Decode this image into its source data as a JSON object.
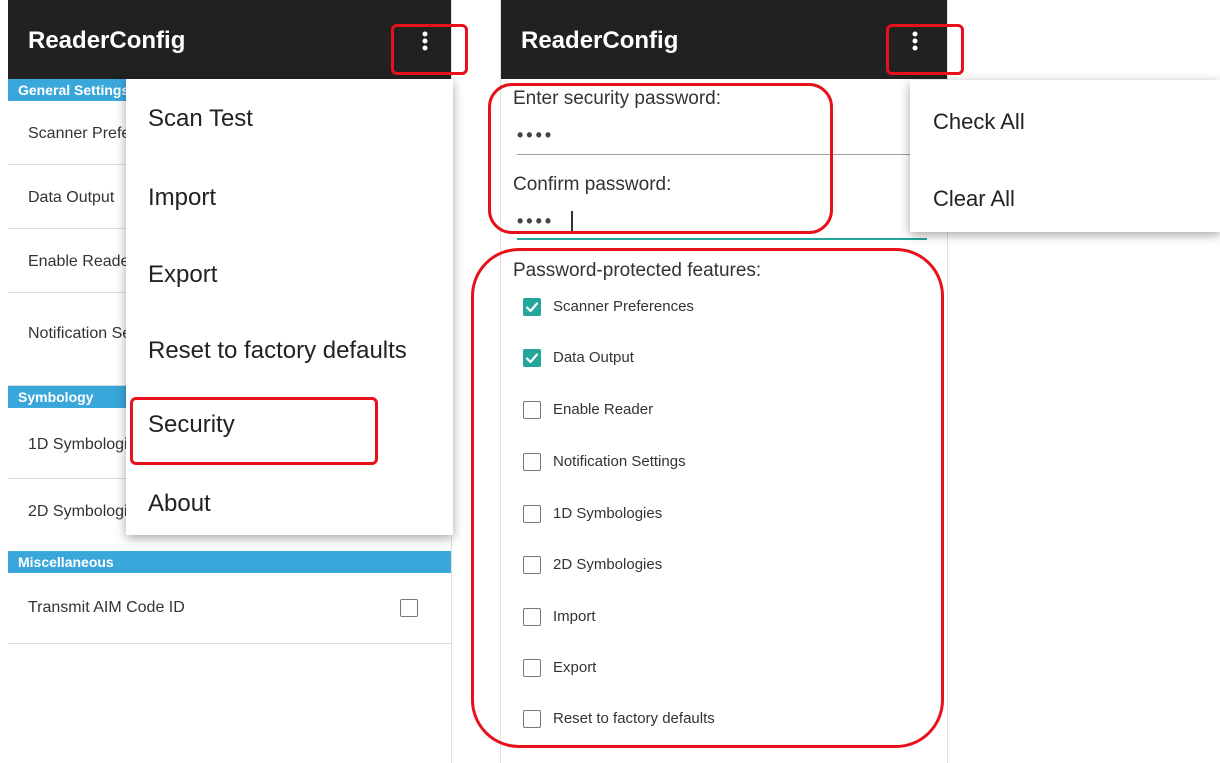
{
  "left_screen": {
    "app_title": "ReaderConfig",
    "sections": {
      "general": "General Settings",
      "symbology": "Symbology",
      "misc": "Miscellaneous"
    },
    "rows": {
      "scanner_preferences": "Scanner Preferences",
      "data_output": "Data Output",
      "enable_reader": "Enable Reader",
      "notification": "Notification Settings",
      "symbologies_1d": "1D Symbologies",
      "symbologies_2d": "2D Symbologies",
      "transmit_aim": "Transmit AIM Code ID"
    },
    "overflow_menu": {
      "scan_test": "Scan Test",
      "import": "Import",
      "export": "Export",
      "reset": "Reset to factory defaults",
      "security": "Security",
      "about": "About"
    }
  },
  "right_screen": {
    "app_title": "ReaderConfig",
    "password_label": "Enter security password:",
    "password_value": "••••",
    "confirm_label": "Confirm password:",
    "confirm_value": "••••",
    "features_label": "Password-protected features:",
    "features": [
      {
        "label": "Scanner Preferences",
        "checked": true
      },
      {
        "label": "Data Output",
        "checked": true
      },
      {
        "label": "Enable Reader",
        "checked": false
      },
      {
        "label": "Notification Settings",
        "checked": false
      },
      {
        "label": "1D Symbologies",
        "checked": false
      },
      {
        "label": "2D Symbologies",
        "checked": false
      },
      {
        "label": "Import",
        "checked": false
      },
      {
        "label": "Export",
        "checked": false
      },
      {
        "label": "Reset to factory defaults",
        "checked": false
      }
    ],
    "popup_menu": {
      "check_all": "Check All",
      "clear_all": "Clear All"
    }
  },
  "colors": {
    "appbar": "#212121",
    "section_header": "#3aa7db",
    "accent_teal": "#26a69a",
    "callout_red": "#e8101a"
  }
}
